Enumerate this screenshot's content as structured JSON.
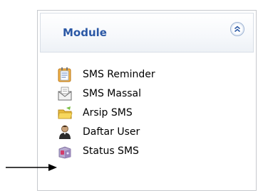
{
  "module_panel": {
    "title": "Module",
    "items": [
      {
        "label": "SMS Reminder",
        "icon": "calendar-icon"
      },
      {
        "label": "SMS Massal",
        "icon": "envelope-icon"
      },
      {
        "label": "Arsip SMS",
        "icon": "folder-icon"
      },
      {
        "label": "Daftar User",
        "icon": "user-icon"
      },
      {
        "label": "Status SMS",
        "icon": "phone-status-icon"
      }
    ]
  },
  "colors": {
    "title": "#2b58a5",
    "border": "#c6c9cd",
    "header_gradient_end": "#edf1f6"
  }
}
